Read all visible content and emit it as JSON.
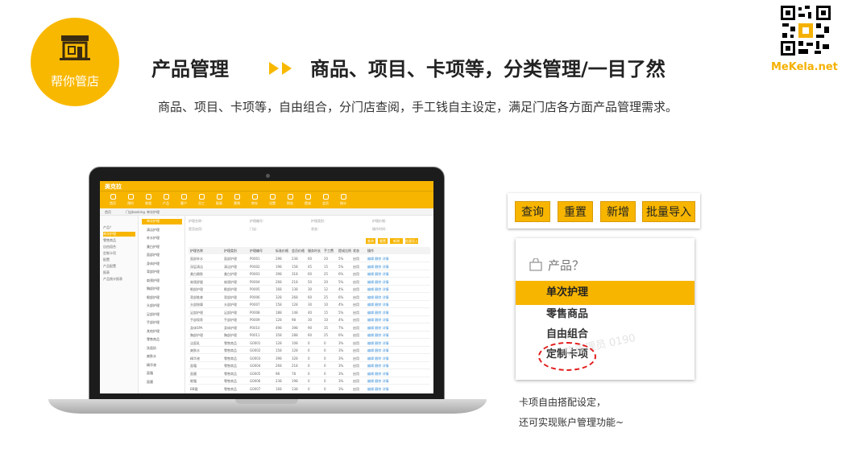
{
  "badge": {
    "label": "帮你管店",
    "color": "#f9b800"
  },
  "header": {
    "title": "产品管理",
    "subtitle": "商品、项目、卡项等，分类管理/一目了然",
    "description": "商品、项目、卡项等，自由组合，分门店查阅，手工钱自主设定，满足门店各方面产品管理需求。",
    "brand": "MeKela.net",
    "accent": "#f9b800"
  },
  "app": {
    "logo": "美克拉",
    "nav": [
      "首页",
      "预约",
      "收银",
      "产品",
      "客户",
      "员工",
      "报表",
      "营销",
      "库存",
      "设置",
      "财务",
      "提成",
      "会员",
      "统计"
    ],
    "tabs": [
      "首页",
      "门店booking",
      "单次护理"
    ],
    "side_primary": [
      "产品？",
      "单次护理",
      "零售商品",
      "自由组合",
      "定制卡项",
      "配置",
      "产品配置",
      "报表",
      "产品统计报表"
    ],
    "side_secondary": [
      "单次护理",
      "清洁护理",
      "补水护理",
      "美白护理",
      "面部护理",
      "身体护理",
      "背部护理",
      "肩颈护理",
      "胸部护理",
      "眼部护理",
      "头部护理",
      "足部护理",
      "手部护理",
      "其他护理",
      "零售商品",
      "洗面奶",
      "爽肤水",
      "精华液",
      "面霜",
      "面膜"
    ],
    "filters": [
      "护理名称：",
      "护理编号：",
      "护理类别：",
      "护理价格：",
      "是否启用：",
      "门店：",
      "状态：",
      "操作时间："
    ],
    "buttons": [
      "查询",
      "重置",
      "新增",
      "批量导入"
    ],
    "columns": [
      "护理名称",
      "护理类别",
      "护理编号",
      "标准价格",
      "会员价格",
      "服务时长",
      "手工费",
      "提成比例",
      "状态",
      "操作"
    ],
    "rows": [
      [
        "面部补水",
        "面部护理",
        "P0001",
        "298",
        "238",
        "60",
        "20",
        "5%",
        "启用",
        "编辑 删除 详情"
      ],
      [
        "深层清洁",
        "清洁护理",
        "P0002",
        "198",
        "158",
        "45",
        "15",
        "5%",
        "启用",
        "编辑 删除 详情"
      ],
      [
        "美白嫩肤",
        "美白护理",
        "P0003",
        "398",
        "318",
        "60",
        "25",
        "6%",
        "启用",
        "编辑 删除 详情"
      ],
      [
        "肩颈舒缓",
        "肩颈护理",
        "P0004",
        "268",
        "218",
        "50",
        "20",
        "5%",
        "启用",
        "编辑 删除 详情"
      ],
      [
        "眼部护理",
        "眼部护理",
        "P0005",
        "168",
        "138",
        "30",
        "12",
        "4%",
        "启用",
        "编辑 删除 详情"
      ],
      [
        "背部推拿",
        "背部护理",
        "P0006",
        "328",
        "268",
        "60",
        "25",
        "6%",
        "启用",
        "编辑 删除 详情"
      ],
      [
        "头部按摩",
        "头部护理",
        "P0007",
        "158",
        "128",
        "30",
        "10",
        "4%",
        "启用",
        "编辑 删除 详情"
      ],
      [
        "足部护理",
        "足部护理",
        "P0008",
        "188",
        "148",
        "40",
        "15",
        "5%",
        "启用",
        "编辑 删除 详情"
      ],
      [
        "手部保养",
        "手部护理",
        "P0009",
        "128",
        "98",
        "30",
        "10",
        "4%",
        "启用",
        "编辑 删除 详情"
      ],
      [
        "身体SPA",
        "身体护理",
        "P0010",
        "498",
        "398",
        "90",
        "35",
        "7%",
        "启用",
        "编辑 删除 详情"
      ],
      [
        "胸部护理",
        "胸部护理",
        "P0011",
        "358",
        "288",
        "60",
        "25",
        "6%",
        "启用",
        "编辑 删除 详情"
      ],
      [
        "洁面乳",
        "零售商品",
        "G0001",
        "128",
        "108",
        "0",
        "0",
        "3%",
        "启用",
        "编辑 删除 详情"
      ],
      [
        "爽肤水",
        "零售商品",
        "G0002",
        "158",
        "128",
        "0",
        "0",
        "3%",
        "启用",
        "编辑 删除 详情"
      ],
      [
        "精华液",
        "零售商品",
        "G0003",
        "398",
        "328",
        "0",
        "0",
        "3%",
        "启用",
        "编辑 删除 详情"
      ],
      [
        "面霜",
        "零售商品",
        "G0004",
        "268",
        "218",
        "0",
        "0",
        "3%",
        "启用",
        "编辑 删除 详情"
      ],
      [
        "面膜",
        "零售商品",
        "G0005",
        "98",
        "78",
        "0",
        "0",
        "3%",
        "启用",
        "编辑 删除 详情"
      ],
      [
        "眼霜",
        "零售商品",
        "G0006",
        "238",
        "198",
        "0",
        "0",
        "3%",
        "启用",
        "编辑 删除 详情"
      ],
      [
        "BB霜",
        "零售商品",
        "G0007",
        "168",
        "138",
        "0",
        "0",
        "3%",
        "启用",
        "编辑 删除 详情"
      ]
    ]
  },
  "zoom": {
    "buttons": [
      "查询",
      "重置",
      "新增",
      "批量导入"
    ],
    "panel_title": "产品？",
    "items": [
      "单次护理",
      "零售商品",
      "自由组合",
      "定制卡项"
    ],
    "active_item": "单次护理",
    "watermark": "店管理员 0190",
    "highlight_color": "#e21a1a"
  },
  "caption": {
    "line1": "卡项自由搭配设定，",
    "line2": "还可实现账户管理功能~"
  }
}
